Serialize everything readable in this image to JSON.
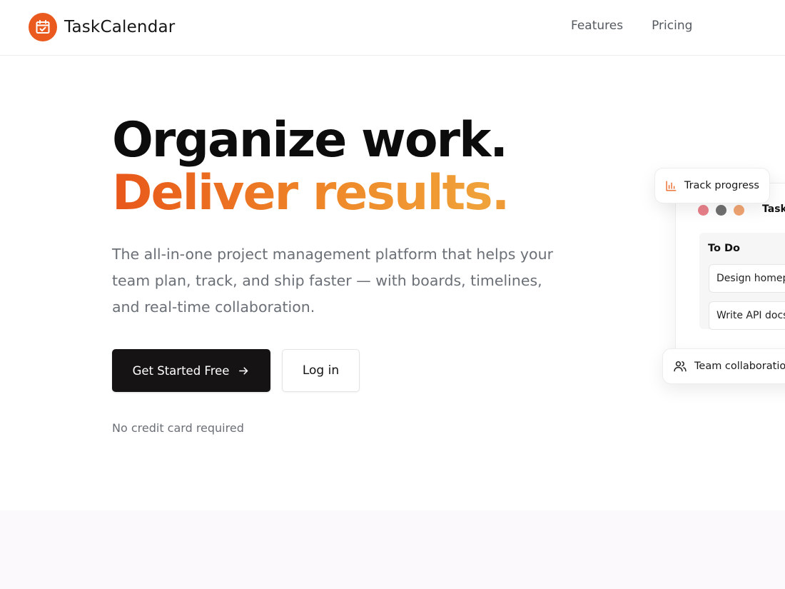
{
  "brand": {
    "name": "TaskCalendar",
    "logo_icon": "calendar-check-icon",
    "accent": "#ea5a1f"
  },
  "nav": {
    "items": [
      {
        "label": "Features"
      },
      {
        "label": "Pricing"
      }
    ]
  },
  "hero": {
    "title_line1": "Organize work.",
    "title_line2": "Deliver results.",
    "subtitle": "The all-in-one project management platform that helps your team plan, track, and ship faster — with boards, timelines, and real-time collaboration.",
    "primary_cta": "Get Started Free",
    "secondary_cta": "Log in",
    "note": "No credit card required"
  },
  "preview": {
    "title": "Task",
    "dot_colors": [
      "#e9808a",
      "#707070",
      "#f0a572"
    ],
    "column_title": "To Do",
    "tasks": [
      {
        "label": "Design homep"
      },
      {
        "label": "Write API docs"
      }
    ],
    "badges": {
      "track": {
        "label": "Track progress",
        "icon": "bar-chart-icon",
        "color": "#ea6a2a"
      },
      "team": {
        "label": "Team collaboration",
        "icon": "users-icon"
      }
    }
  }
}
